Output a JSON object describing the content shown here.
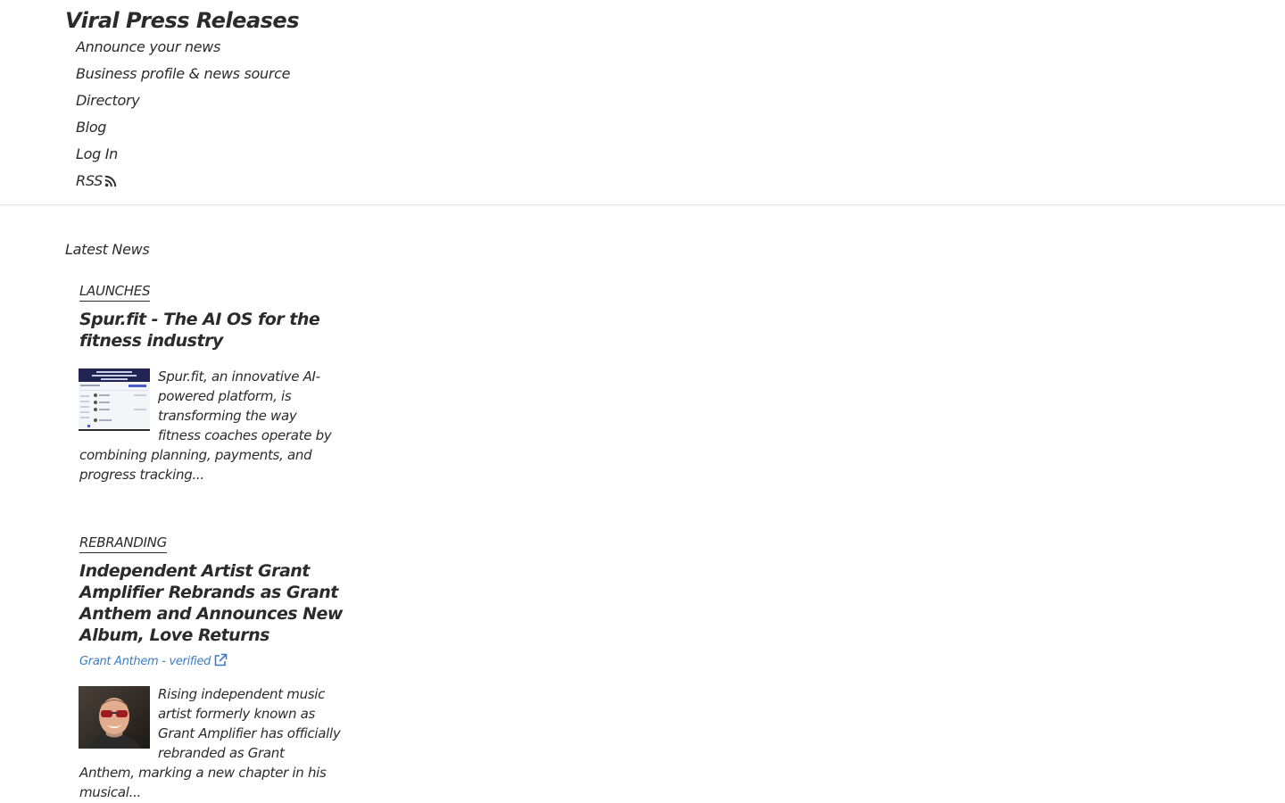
{
  "header": {
    "site_title": "Viral Press Releases",
    "nav": [
      {
        "label": "Announce your news"
      },
      {
        "label": "Business profile & news source"
      },
      {
        "label": "Directory"
      },
      {
        "label": "Blog"
      },
      {
        "label": "Log In"
      },
      {
        "label": "RSS",
        "icon": "rss-icon"
      }
    ]
  },
  "main": {
    "section_title": "Latest News",
    "articles": [
      {
        "category": "LAUNCHES",
        "title": "Spur.fit - The AI OS for the fitness industry",
        "thumbnail_icon": "product-screenshot-thumbnail",
        "excerpt": "Spur.fit, an innovative AI-powered platform, is transforming the way fitness coaches operate by combining planning, payments, and progress tracking..."
      },
      {
        "category": "REBRANDING",
        "title": "Independent Artist Grant Amplifier Rebrands as Grant Anthem and Announces New Album, Love Returns",
        "source": "Grant Anthem - verified",
        "source_icon": "external-link-icon",
        "thumbnail_icon": "artist-portrait-thumbnail",
        "excerpt": "Rising independent music artist formerly known as Grant Amplifier has officially rebranded as Grant Anthem, marking a new chapter in his musical..."
      }
    ]
  },
  "colors": {
    "text": "#2b2b2b",
    "link_blue": "#3a7bc8",
    "divider": "#e4e4e4"
  }
}
